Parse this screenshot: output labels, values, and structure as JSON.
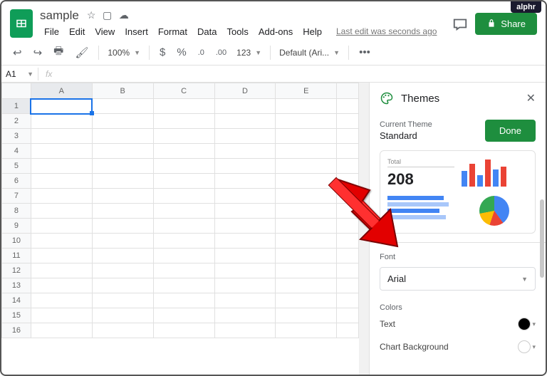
{
  "watermark": "alphr",
  "doc": {
    "name": "sample"
  },
  "menus": [
    "File",
    "Edit",
    "View",
    "Insert",
    "Format",
    "Data",
    "Tools",
    "Add-ons",
    "Help"
  ],
  "lastedit": "Last edit was seconds ago",
  "share": "Share",
  "toolbar": {
    "zoom": "100%",
    "fmt123": "123",
    "font": "Default (Ari...",
    "dollar": "$",
    "percent": "%",
    "dec0": ".0",
    "dec00": ".00",
    "more": "•••"
  },
  "fx": {
    "cell": "A1",
    "symbol": "fx"
  },
  "columns": [
    "A",
    "B",
    "C",
    "D",
    "E"
  ],
  "rows": [
    "1",
    "2",
    "3",
    "4",
    "5",
    "6",
    "7",
    "8",
    "9",
    "10",
    "11",
    "12",
    "13",
    "14",
    "15",
    "16"
  ],
  "panel": {
    "title": "Themes",
    "current_label": "Current Theme",
    "current_name": "Standard",
    "done": "Done",
    "preview_total_label": "Total",
    "preview_total_value": "208",
    "font_label": "Font",
    "font_value": "Arial",
    "colors_label": "Colors",
    "color_text": "Text",
    "color_bg": "Chart Background"
  }
}
